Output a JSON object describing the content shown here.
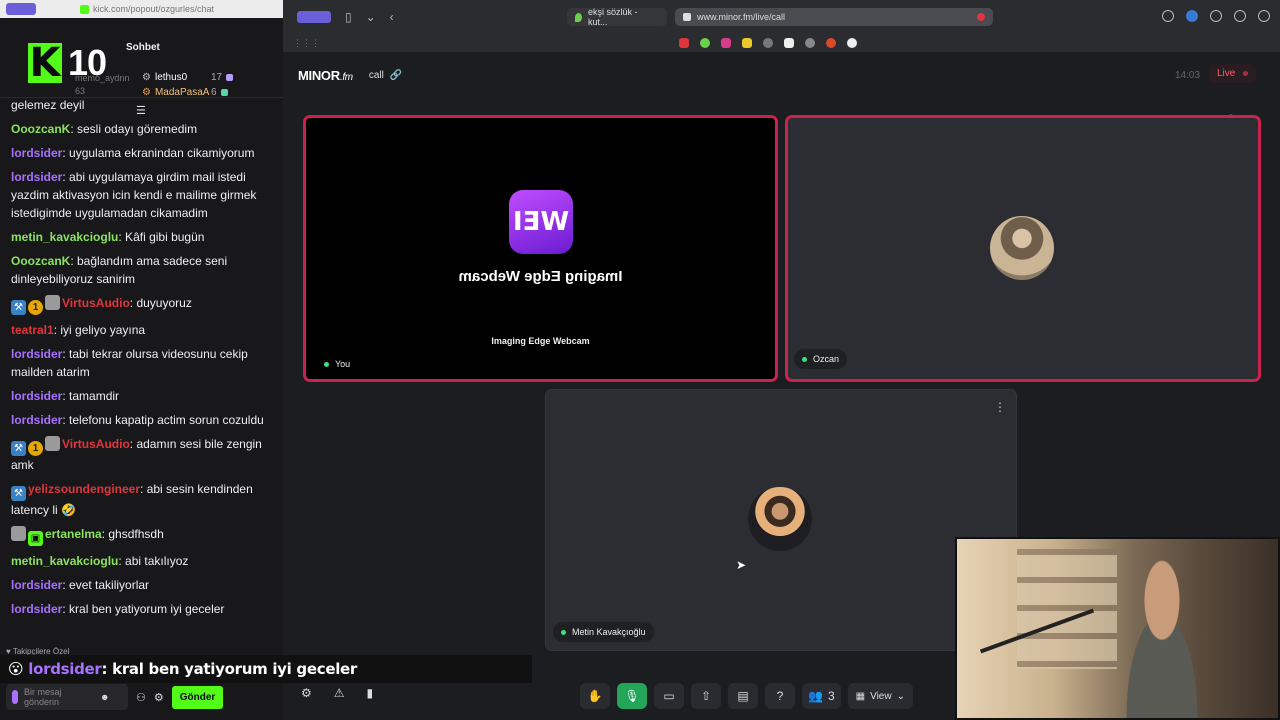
{
  "chat_window": {
    "url": "kick.com/popout/ozgurles/chat",
    "k_number": "10",
    "title": "Sohbet",
    "leaderboard_ghost": [
      "memo_aydnn",
      "63"
    ],
    "leaderboard": [
      {
        "name": "lethus0",
        "count": "17",
        "gem_color": "#b59cff"
      },
      {
        "name": "MadaPasaA",
        "count": "6",
        "gem_color": "#53d7a8"
      }
    ],
    "messages": [
      {
        "user": "",
        "text": "gelemez deyil",
        "color": "#efeff1"
      },
      {
        "user": "OoozcanK",
        "text": ": sesli odayı göremedim",
        "color": "#8be35f"
      },
      {
        "user": "lordsider",
        "text": ": uygulama ekranindan cikamiyorum",
        "color": "#a871ff"
      },
      {
        "user": "lordsider",
        "text": ": abi uygulamaya girdim mail istedi yazdim aktivasyon icin kendi e mailime girmek istedigimde uygulamadan cikamadim",
        "color": "#a871ff"
      },
      {
        "user": "metin_kavakcioglu",
        "text": ": Kâfi gibi bugün",
        "color": "#8be35f"
      },
      {
        "user": "OoozcanK",
        "text": ": bağlandım ama sadece seni dinleyebiliyoruz sanirim",
        "color": "#8be35f"
      },
      {
        "user": "VirtusAudio",
        "text": ": duyuyoruz",
        "color": "#e0353d",
        "badges": [
          "hammer",
          "one",
          "pix"
        ]
      },
      {
        "user": "teatral1",
        "text": ": iyi geliyo yayına",
        "color": "#e0353d"
      },
      {
        "user": "lordsider",
        "text": ": tabi tekrar olursa videosunu cekip mailden atarim",
        "color": "#a871ff"
      },
      {
        "user": "lordsider",
        "text": ": tamamdir",
        "color": "#a871ff"
      },
      {
        "user": "lordsider",
        "text": ": telefonu kapatip actim sorun cozuldu",
        "color": "#a871ff"
      },
      {
        "user": "VirtusAudio",
        "text": ": adamın sesi bile zengin amk",
        "color": "#e0353d",
        "badges": [
          "hammer",
          "one",
          "pix"
        ]
      },
      {
        "user": "yelizsoundengineer",
        "text": ": abi sesin kendinden latency li 🤣",
        "color": "#e0353d",
        "badges": [
          "hammer"
        ]
      },
      {
        "user": "ertanelma",
        "text": ": ghsdfhsdh",
        "color": "#8be35f",
        "badges": [
          "pix",
          "gift"
        ]
      },
      {
        "user": "metin_kavakcioglu",
        "text": ": abi takılıyoz",
        "color": "#8be35f"
      },
      {
        "user": "lordsider",
        "text": ": evet takiliyorlar",
        "color": "#a871ff"
      },
      {
        "user": "lordsider",
        "text": ": kral ben yatiyorum iyi geceler",
        "color": "#a871ff"
      }
    ],
    "followers_only": "Takipçilere Özel",
    "caption": {
      "user": "lordsider",
      "text": ": kral ben yatiyorum iyi geceler"
    },
    "input_placeholder": "Bir mesaj gönderin",
    "send_label": "Gönder"
  },
  "browser": {
    "tabs": [
      {
        "label": "ekşi sözlük - kut..."
      },
      {
        "label": "www.minor.fm/live/call"
      }
    ]
  },
  "app": {
    "logo": "MINOR",
    "logo_suffix": ".fm",
    "call_label": "call",
    "time": "14:03",
    "live_label": "Live",
    "tiles": {
      "you": {
        "logo_text": "WEI",
        "mirrored_title": "Imaging Edge Webcam",
        "caption": "Imaging Edge Webcam",
        "name": "You"
      },
      "ozcan": {
        "name": "Ozcan"
      },
      "metin": {
        "name": "Metin Kavakçıoğlu"
      }
    },
    "participants_count": "3",
    "view_label": "View"
  }
}
